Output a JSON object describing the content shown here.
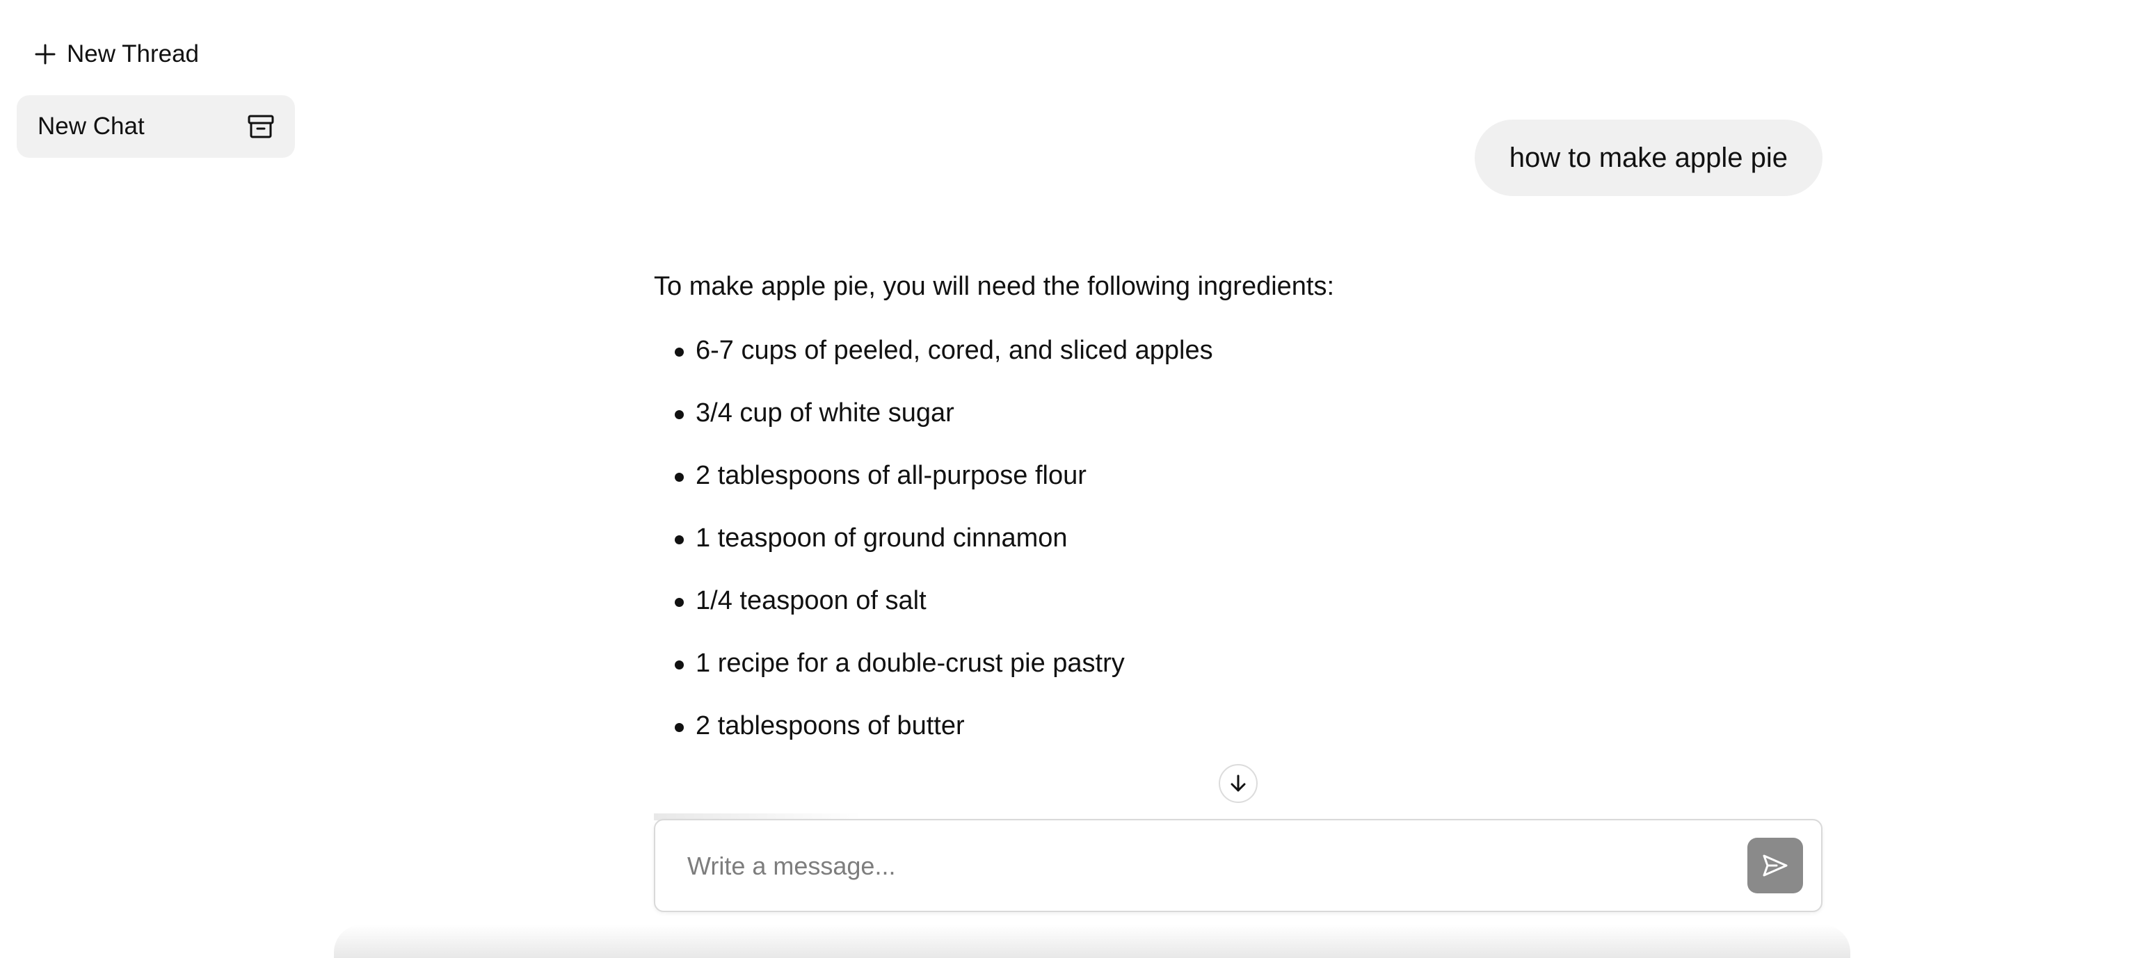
{
  "sidebar": {
    "new_thread_label": "New Thread",
    "threads": [
      {
        "label": "New Chat"
      }
    ]
  },
  "conversation": {
    "user_message": "how to make apple pie",
    "assistant_intro": "To make apple pie, you will need the following ingredients:",
    "ingredients": [
      "6-7 cups of peeled, cored, and sliced apples",
      "3/4 cup of white sugar",
      "2 tablespoons of all-purpose flour",
      "1 teaspoon of ground cinnamon",
      "1/4 teaspoon of salt",
      "1 recipe for a double-crust pie pastry",
      "2 tablespoons of butter"
    ]
  },
  "composer": {
    "placeholder": "Write a message..."
  },
  "icons": {
    "new_thread": "plus-icon",
    "thread_action": "archive-icon",
    "scroll": "arrow-down-icon",
    "send": "send-icon"
  },
  "colors": {
    "bubble_bg": "#f0f0f0",
    "thread_bg": "#f1f1f1",
    "send_button": "#8a8a8a",
    "text": "#111111",
    "placeholder": "#7d7d7d"
  }
}
